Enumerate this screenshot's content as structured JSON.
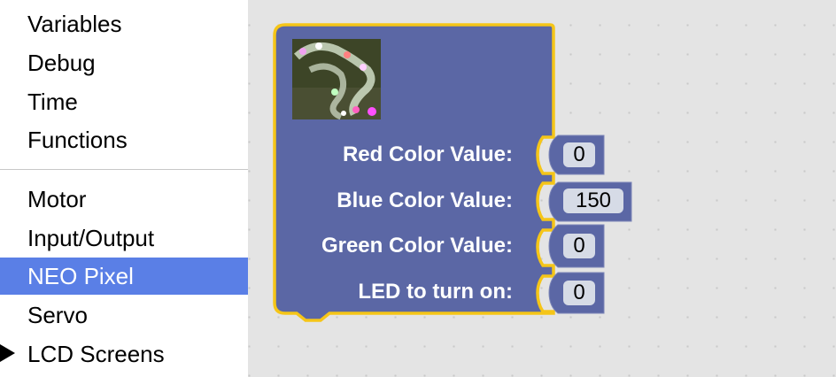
{
  "toolbox": {
    "items": [
      {
        "label": "Variables"
      },
      {
        "label": "Debug"
      },
      {
        "label": "Time"
      },
      {
        "label": "Functions"
      },
      {
        "label": "Motor"
      },
      {
        "label": "Input/Output"
      },
      {
        "label": "NEO Pixel",
        "selected": true
      },
      {
        "label": "Servo"
      },
      {
        "label": "LCD Screens",
        "expandable": true
      }
    ]
  },
  "block": {
    "color": "#5b67a5",
    "outline": "#f5c518",
    "image": "neopixel-led-strip-image",
    "inputs": [
      {
        "label": "Red Color Value:",
        "value": "0"
      },
      {
        "label": "Blue Color Value:",
        "value": "150"
      },
      {
        "label": "Green Color Value:",
        "value": "0"
      },
      {
        "label": "LED to turn on:",
        "value": "0"
      }
    ]
  }
}
